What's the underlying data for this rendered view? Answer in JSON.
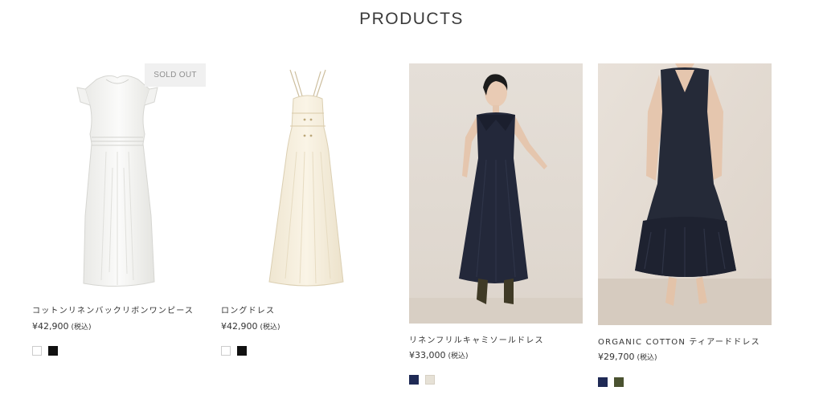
{
  "section": {
    "title": "PRODUCTS"
  },
  "products": [
    {
      "name": "コットンリネンバックリボンワンピース",
      "price": "¥42,900",
      "tax": "(税込)",
      "badge": "SOLD OUT",
      "swatch_colors": [
        "#ffffff",
        "#111111"
      ]
    },
    {
      "name": "ロングドレス",
      "price": "¥42,900",
      "tax": "(税込)",
      "swatch_colors": [
        "#ffffff",
        "#111111"
      ]
    },
    {
      "name": "リネンフリルキャミソールドレス",
      "price": "¥33,000",
      "tax": "(税込)",
      "swatch_colors": [
        "#1f2a55",
        "#e6e1d6"
      ]
    },
    {
      "name": "ORGANIC COTTON ティアードドレス",
      "price": "¥29,700",
      "tax": "(税込)",
      "swatch_colors": [
        "#1f2a55",
        "#4a5230"
      ]
    }
  ]
}
